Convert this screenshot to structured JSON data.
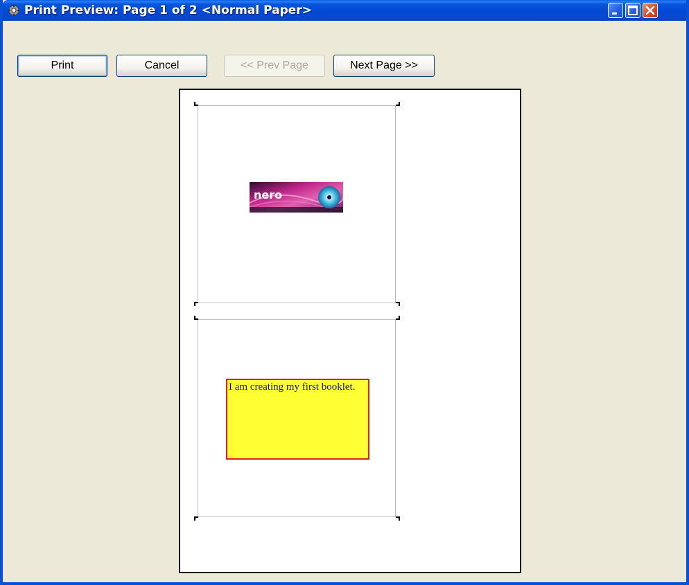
{
  "window": {
    "title": "Print Preview: Page 1 of 2 <Normal Paper>",
    "icon": "printer-preview-icon",
    "controls": {
      "minimize": "minimize-icon",
      "maximize": "maximize-icon",
      "close": "close-icon"
    }
  },
  "toolbar": {
    "print_label": "Print",
    "cancel_label": "Cancel",
    "prev_label": "<< Prev Page",
    "next_label": "Next Page >>"
  },
  "preview": {
    "logo_text": "nero",
    "textbox_text": "I am creating my first booklet.",
    "colors": {
      "textbox_fill": "#FFFF33",
      "textbox_border": "#E02020",
      "textbox_text": "#1010C8"
    }
  }
}
